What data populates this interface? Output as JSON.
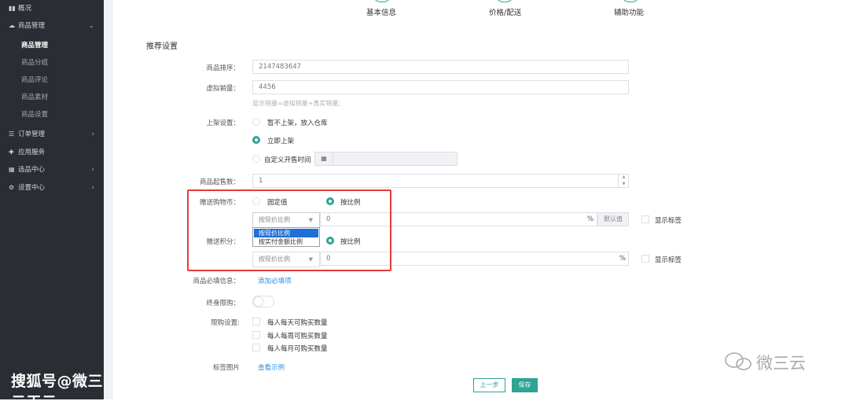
{
  "sidebar": {
    "overview": "概况",
    "goods_mgmt": "商品管理",
    "goods_sub": [
      "商品管理",
      "商品分组",
      "商品评论",
      "商品素材",
      "商品设置"
    ],
    "order_mgmt": "订单管理",
    "app_service": "应用服务",
    "selection_center": "选品中心",
    "settings_center": "设置中心"
  },
  "steps": [
    "基本信息",
    "价格/配送",
    "辅助功能"
  ],
  "section_title": "推荐设置",
  "form": {
    "sort_label": "商品排序：",
    "sort_value": "2147483647",
    "virtual_sales_label": "虚拟销量：",
    "virtual_sales_value": "4456",
    "virtual_sales_hint": "显示销量=虚拟销量+真实销量;",
    "shelf_label": "上架设置：",
    "shelf_options": [
      "暂不上架，放入仓库",
      "立即上架",
      "自定义开售时间"
    ],
    "min_qty_label": "商品起售数：",
    "min_qty_value": "1",
    "gift_coin_label": "赠送购物币：",
    "gift_coin_options": [
      "固定值",
      "按比例"
    ],
    "gift_coin_select": "按现价比例",
    "gift_coin_value": "0",
    "percent": "%",
    "default_btn": "默认值",
    "show_tag": "显示标签",
    "dropdown_options": [
      "按现价比例",
      "按实付金额比例"
    ],
    "gift_points_label": "赠送积分：",
    "gift_points_option": "按比例",
    "gift_points_select": "按现价比例",
    "gift_points_value": "0",
    "required_info_label": "商品必填信息：",
    "required_info_link": "添加必填项",
    "lifetime_limit_label": "终身限购：",
    "purchase_limit_label": "限购设置:",
    "purchase_limit_options": [
      "每人每天可购买数量",
      "每人每周可购买数量",
      "每人每月可购买数量"
    ],
    "tag_image_label": "标签图片",
    "tag_image_link": "查看示例"
  },
  "buttons": {
    "prev": "上一步",
    "save": "保存"
  },
  "watermarks": {
    "left": "搜狐号@微三云王云",
    "right": "微三云"
  },
  "colors": {
    "accent": "#2fa395",
    "highlight": "#e23b3b",
    "sidebar_bg": "#2a2d33",
    "link": "#2b8de0"
  }
}
